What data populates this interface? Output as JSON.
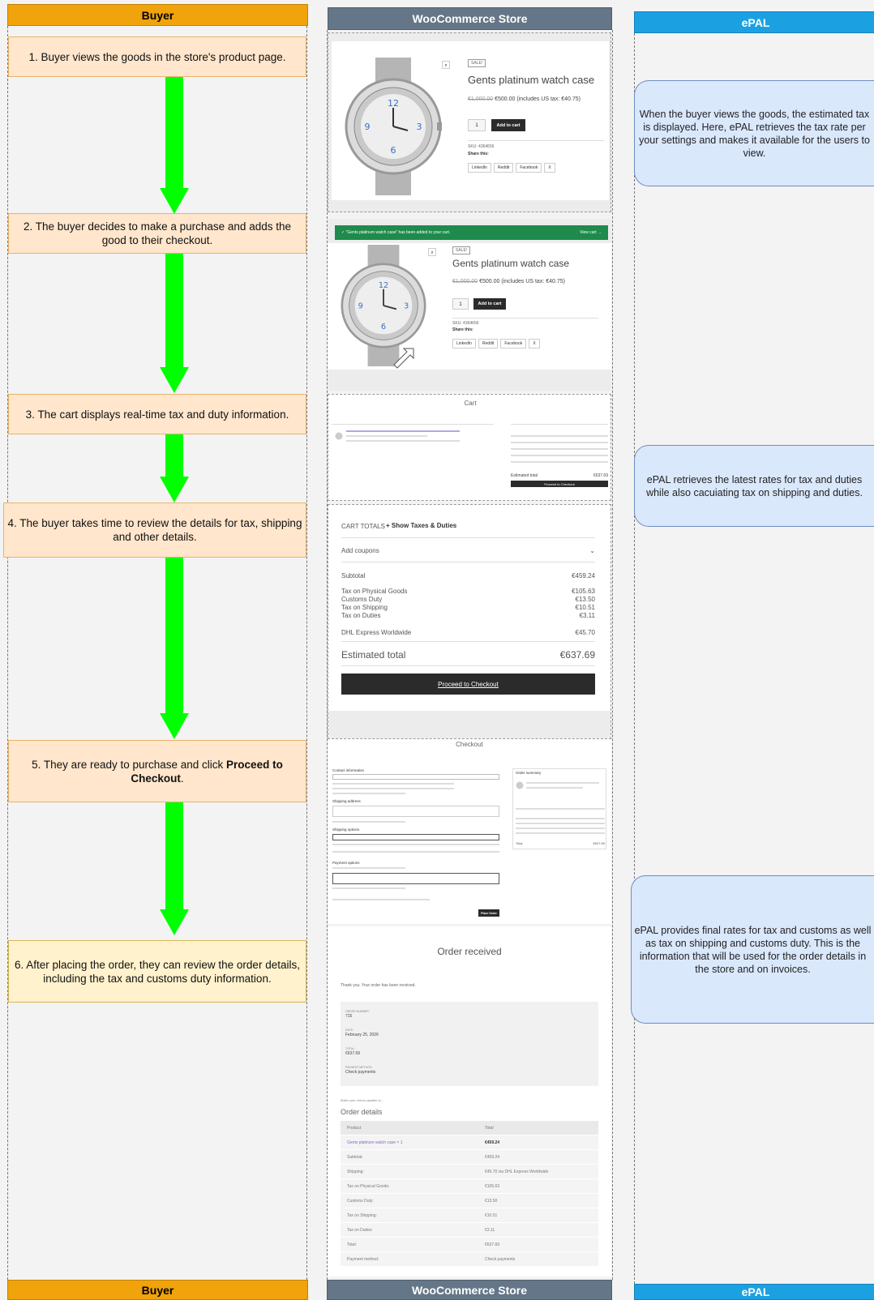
{
  "lanes": {
    "buyer": "Buyer",
    "store": "WooCommerce Store",
    "epal": "ePAL"
  },
  "steps": [
    {
      "text": "1. Buyer views the goods in the store's product page."
    },
    {
      "text": "2. The buyer decides to make a purchase and adds the good to their checkout."
    },
    {
      "text": "3. The cart displays real-time tax and duty information."
    },
    {
      "text": "4. The buyer takes time to review the details for tax, shipping and other details."
    },
    {
      "prefix": "5. They are ready to purchase and click ",
      "bold": "Proceed to Checkout",
      "suffix": "."
    },
    {
      "text": "6. After placing the order, they can review the order details, including the tax and customs duty information."
    }
  ],
  "notes": [
    "When the buyer views the goods, the estimated tax is displayed. Here, ePAL retrieves the tax rate per your settings and makes it available for the users to view.",
    "ePAL retrieves the latest rates for tax and duties while also cacuiating tax on shipping and duties.",
    "ePAL provides final rates for tax and customs as well as tax on shipping and customs duty. This is the information that will be used for the order details in the store and on invoices."
  ],
  "product": {
    "sale_badge": "SALE!",
    "name": "Gents platinum watch case",
    "old_price": "€1,000.00",
    "price": "€500.00 (includes US tax: €40.75)",
    "qty": "1",
    "add_to_cart": "Add to cart",
    "sku": "SKU: 4364656",
    "share_label": "Share this:",
    "share": [
      "LinkedIn",
      "Reddit",
      "Facebook",
      "X"
    ],
    "added_notice": "\"Gents platinum watch case\" has been added to your cart.",
    "view_cart": "View cart"
  },
  "cart": {
    "title": "Cart",
    "totals_title": "CART TOTALS",
    "show_taxes": "+ Show Taxes & Duties",
    "add_coupons": "Add coupons",
    "rows": [
      {
        "label": "Subtotal",
        "value": "€459.24"
      },
      {
        "label": "Tax on Physical Goods",
        "value": "€105.63"
      },
      {
        "label": "Customs Duty",
        "value": "€13.50"
      },
      {
        "label": "Tax on Shipping",
        "value": "€10.51"
      },
      {
        "label": "Tax on Duties",
        "value": "€3.11"
      },
      {
        "label": "DHL Express Worldwide",
        "value": "€45.70"
      }
    ],
    "estimated_label": "Estimated total",
    "estimated_value": "€637.69",
    "proceed": "Proceed to Checkout"
  },
  "checkout": {
    "title": "Checkout",
    "contact": "Contact information",
    "shipping_address": "Shipping address",
    "shipping_options": "Shipping options",
    "payment_options": "Payment options",
    "order_summary": "Order summary",
    "total_label": "Total",
    "total_value": "€637.69",
    "place_order": "Place Order"
  },
  "order": {
    "title": "Order received",
    "thanks": "Thank you. Your order has been received.",
    "fields": [
      {
        "label": "ORDER NUMBER:",
        "value": "715"
      },
      {
        "label": "DATE:",
        "value": "February 25, 2026"
      },
      {
        "label": "TOTAL:",
        "value": "€637.69"
      },
      {
        "label": "PAYMENT METHOD:",
        "value": "Check payments"
      }
    ],
    "make_check": "Make your check payable to...",
    "details_title": "Order details",
    "table": [
      {
        "label": "Product",
        "value": "Total"
      },
      {
        "label": "Gents platinum watch case × 1",
        "value": "€459.24"
      },
      {
        "label": "Subtotal:",
        "value": "€459.24"
      },
      {
        "label": "Shipping:",
        "value": "€45.70 via DHL Express Worldwide"
      },
      {
        "label": "Tax on Physical Goods:",
        "value": "€105.63"
      },
      {
        "label": "Customs Duty:",
        "value": "€13.50"
      },
      {
        "label": "Tax on Shipping:",
        "value": "€10.51"
      },
      {
        "label": "Tax on Duties:",
        "value": "€3.11"
      },
      {
        "label": "Total:",
        "value": "€637.69"
      },
      {
        "label": "Payment method:",
        "value": "Check payments"
      }
    ]
  },
  "colors": {
    "buyer_lane": "#f0a30a",
    "store_lane": "#647687",
    "epal_lane": "#1ba1e2",
    "step_fill": "#ffe6cc",
    "note_fill": "#dae8fc",
    "arrow": "#00ff00"
  }
}
